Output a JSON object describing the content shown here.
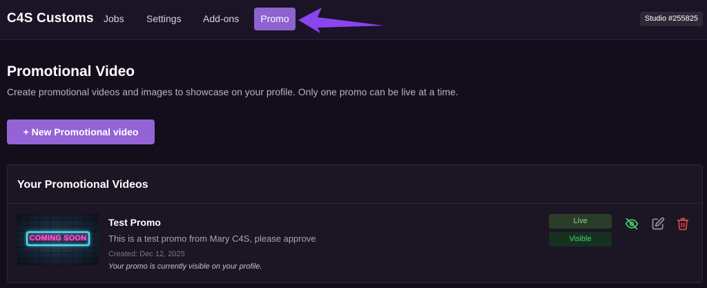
{
  "header": {
    "brand": "C4S Customs",
    "nav": [
      {
        "label": "Jobs"
      },
      {
        "label": "Settings"
      },
      {
        "label": "Add-ons"
      },
      {
        "label": "Promo"
      }
    ],
    "studio_badge": "Studio #255825"
  },
  "page": {
    "title": "Promotional Video",
    "description": "Create promotional videos and images to showcase on your profile. Only one promo can be live at a time.",
    "new_button": "+ New Promotional video"
  },
  "panel": {
    "title": "Your Promotional Videos",
    "items": [
      {
        "thumbnail_text": "COMING SOON",
        "title": "Test Promo",
        "description": "This is a test promo from Mary C4S, please approve",
        "created": "Created: Dec 12, 2025",
        "note": "Your promo is currently visible on your profile.",
        "status_live": "Live",
        "status_visible": "Visible",
        "actions": [
          "eye-off-icon",
          "edit-icon",
          "trash-icon"
        ]
      }
    ]
  },
  "colors": {
    "accent": "#9464d6",
    "live_text": "#7ee07a",
    "visible_text": "#3fd96e",
    "delete": "#e5484d",
    "toggle": "#46d36c"
  }
}
